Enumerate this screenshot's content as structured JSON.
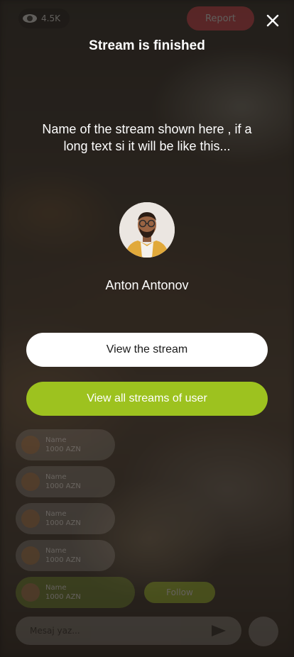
{
  "header": {
    "title": "Stream is finished",
    "close_icon": "close-icon"
  },
  "stream": {
    "name": "Name of the stream shown here , if a long text si it will be like this..."
  },
  "user": {
    "name": "Anton Antonov",
    "avatar_icon": "avatar"
  },
  "actions": {
    "view_stream_label": "View the stream",
    "view_all_label": "View all streams of user"
  },
  "background_ui": {
    "viewers": "4.5K",
    "report_label": "Report",
    "chat": [
      {
        "name": "Name",
        "amount": "1000 AZN"
      },
      {
        "name": "Name",
        "amount": "1000 AZN"
      },
      {
        "name": "Name",
        "amount": "1000 AZN"
      },
      {
        "name": "Name",
        "amount": "1000 AZN"
      },
      {
        "name": "Name",
        "amount": "1000 AZN"
      }
    ],
    "follow_label": "Follow",
    "message_placeholder": "Mesaj yaz..."
  },
  "colors": {
    "accent": "#9dc21f",
    "report": "#e53946",
    "button_light": "#ffffff"
  }
}
